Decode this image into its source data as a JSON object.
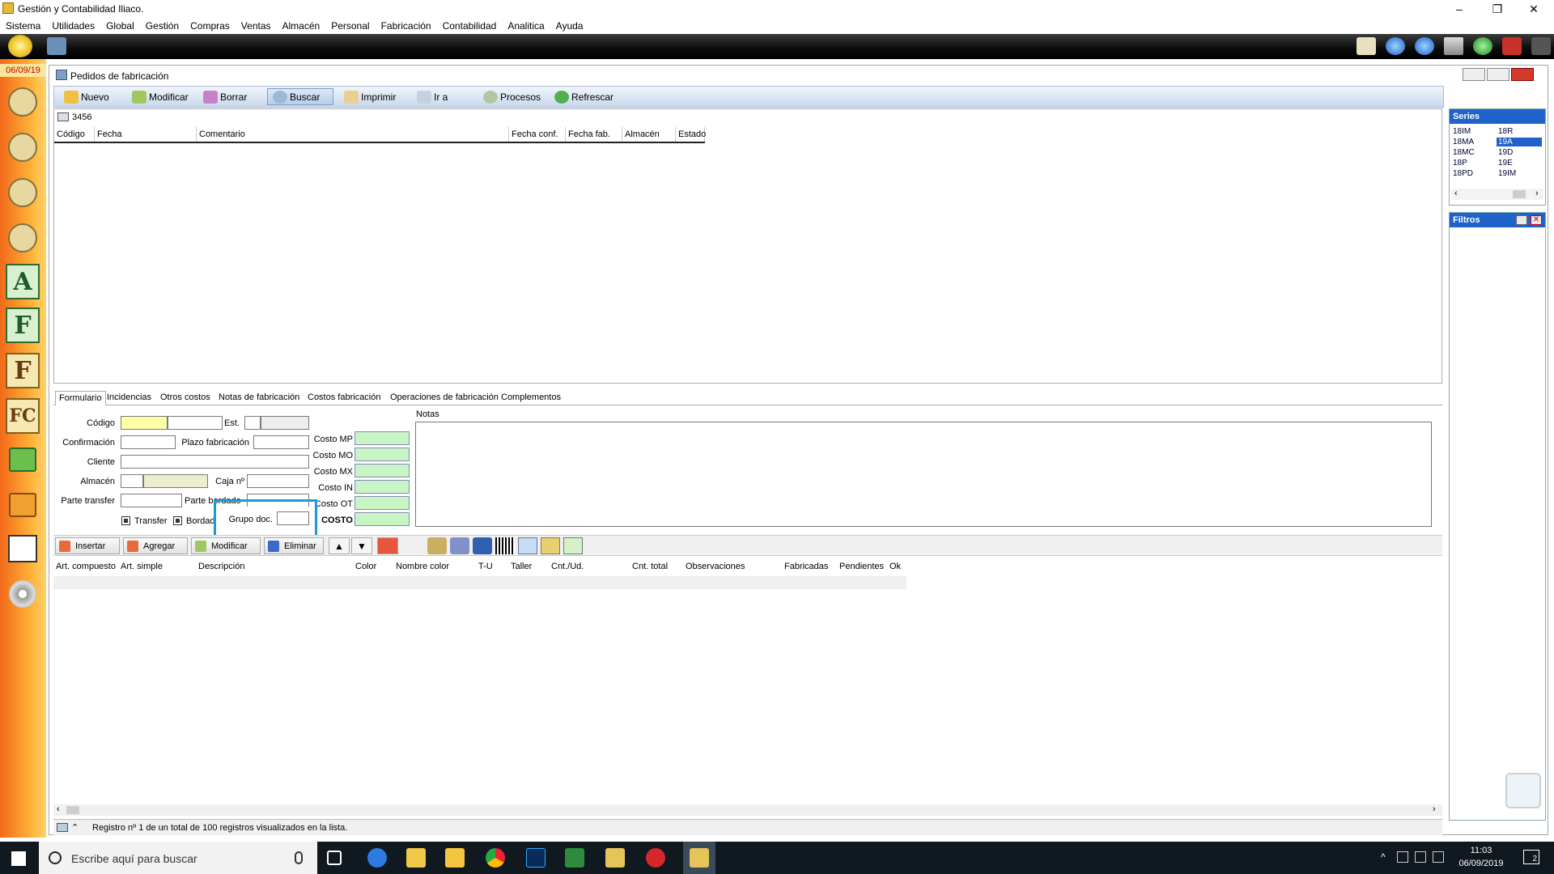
{
  "window": {
    "title": "Gestión y Contabilidad Iliaco.",
    "minimize": "–",
    "restore": "❐",
    "close": "✕"
  },
  "menu": [
    "Sistema",
    "Utilidades",
    "Global",
    "Gestión",
    "Compras",
    "Ventas",
    "Almacén",
    "Personal",
    "Fabricación",
    "Contabilidad",
    "Analitica",
    "Ayuda"
  ],
  "sidebar": {
    "date": "06/09/19",
    "letters": [
      "A",
      "F",
      "F",
      "FC"
    ]
  },
  "inner": {
    "title": "Pedidos de fabricación",
    "toolbar": {
      "nuevo": "Nuevo",
      "modificar": "Modificar",
      "borrar": "Borrar",
      "buscar": "Buscar",
      "imprimir": "Imprimir",
      "ir_a": "Ir a",
      "procesos": "Procesos",
      "refrescar": "Refrescar"
    }
  },
  "list": {
    "search_value": "3456",
    "columns": [
      "Código",
      "Fecha",
      "Comentario",
      "Fecha conf.",
      "Fecha fab.",
      "Almacén",
      "Estado"
    ]
  },
  "series": {
    "title": "Series",
    "col1": [
      "18IM",
      "18MA",
      "18MC",
      "18P",
      "18PD"
    ],
    "col2": [
      "18R",
      "19A",
      "19D",
      "19E",
      "19IM"
    ],
    "selected": "19A"
  },
  "filtros": {
    "title": "Filtros"
  },
  "tabs": [
    "Formulario",
    "Incidencias",
    "Otros costos",
    "Notas de fabricación",
    "Costos fabricación",
    "Operaciones de fabricación",
    "Complementos"
  ],
  "form": {
    "codigo": "Código",
    "est": "Est.",
    "confirmacion": "Confirmación",
    "plazo": "Plazo fabricación",
    "cliente": "Cliente",
    "almacen": "Almacén",
    "caja": "Caja nº",
    "parte_transfer": "Parte transfer",
    "parte_bordado": "Parte bordado",
    "transfer": "Transfer",
    "bordado": "Bordado",
    "grupo_doc": "Grupo doc.",
    "notas": "Notas",
    "costs": [
      "Costo MP",
      "Costo MO",
      "Costo MX",
      "Costo IN",
      "Costo OT",
      "COSTO"
    ]
  },
  "line_toolbar": {
    "insertar": "Insertar",
    "agregar": "Agregar",
    "modificar": "Modificar",
    "eliminar": "Eliminar"
  },
  "lines": {
    "columns": [
      "Art. compuesto",
      "Art. simple",
      "Descripción",
      "Color",
      "Nombre color",
      "T-U",
      "Taller",
      "Cnt./Ud.",
      "Cnt. total",
      "Observaciones",
      "Fabricadas",
      "Pendientes",
      "Ok"
    ]
  },
  "status": {
    "text": "Registro nº 1 de un total de 100 registros visualizados en la lista."
  },
  "taskbar": {
    "search_placeholder": "Escribe aquí para buscar",
    "time": "11:03",
    "date": "06/09/2019",
    "notifications": "2"
  },
  "colors": {
    "highlight": "#1b9ad6",
    "panel_header": "#1f62c9",
    "cost_fields": "#c7f5c4",
    "required_field": "#ffffa8"
  }
}
